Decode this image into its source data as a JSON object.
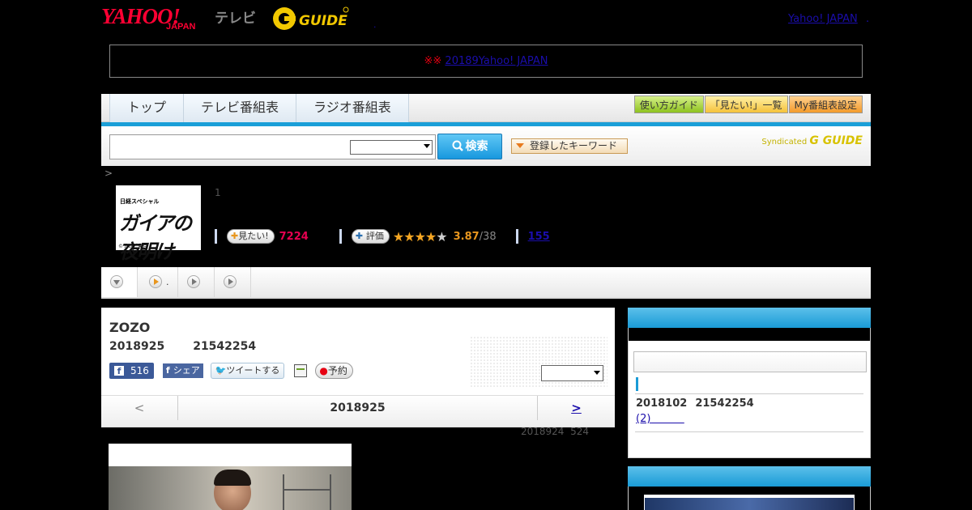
{
  "header": {
    "logo_yahoo": "YAHOO!",
    "logo_japan": "JAPAN",
    "logo_tv": "テレビ",
    "logo_gguide": "G GUIDE",
    "dot": ".",
    "yahoo_japan_link": "Yahoo! JAPAN",
    "extra_link": "."
  },
  "notice": {
    "mark": "※※",
    "link": "20189Yahoo! JAPAN"
  },
  "nav": {
    "tabs": [
      "トップ",
      "テレビ番組表",
      "ラジオ番組表"
    ],
    "buttons": [
      "使い方ガイド",
      "「見たい!」一覧",
      "My番組表設定"
    ]
  },
  "search": {
    "button": "検索",
    "keyword_button": "登録したキーワード",
    "syndicated": "Syndicated",
    "syndicated_brand": "G GUIDE"
  },
  "breadcrumb": ">",
  "program": {
    "image_text_top": "日経スペシャル",
    "image_text_main": "ガイアの夜明け",
    "image_text_credit": "©テレビ東京",
    "episode_num": "1",
    "want_label": "見たい!",
    "want_count": "7224",
    "rate_label": "評価",
    "rating": "3.87",
    "rating_total": "/38",
    "count_link": "155"
  },
  "subnav": {
    "item2_text": "."
  },
  "article": {
    "title": "ZOZO",
    "date": "2018925",
    "code": "21542254",
    "fb_count": "516",
    "fb_share": "シェア",
    "tweet": "ツイートする",
    "reserve": "予約"
  },
  "pager": {
    "prev": "<",
    "date": "2018925",
    "next": ">",
    "sub_date": "2018924",
    "sub_count": "524"
  },
  "side": {
    "date": "2018102",
    "code": "21542254",
    "link": "(2)"
  }
}
